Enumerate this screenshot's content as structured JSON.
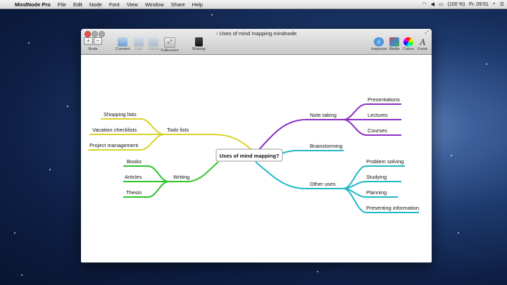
{
  "menubar": {
    "app_name": "MindNode Pro",
    "items": [
      "File",
      "Edit",
      "Node",
      "Font",
      "View",
      "Window",
      "Share",
      "Help"
    ],
    "battery": "(100 %)",
    "clock": "Fr. 09:51"
  },
  "window": {
    "title": "Uses of mind mapping.mindnode",
    "toolbar": {
      "node_label": "Node",
      "node_add": "+",
      "node_remove": "−",
      "connect": "Connect",
      "fold": "Fold",
      "unfold": "Unfold",
      "fullscreen": "Fullscreen",
      "sharing": "Sharing",
      "inspector": "Inspector",
      "media": "Media",
      "colors": "Colors",
      "fonts": "Fonts"
    }
  },
  "mindmap": {
    "root": "Uses of mind mapping?",
    "branches": {
      "note_taking": {
        "label": "Note taking",
        "children": [
          "Presentations",
          "Lectures",
          "Courses"
        ]
      },
      "brainstorming": {
        "label": "Brainstorming"
      },
      "other_uses": {
        "label": "Other uses",
        "children": [
          "Problem solving",
          "Studying",
          "Planning",
          "Presenting information"
        ]
      },
      "todo_lists": {
        "label": "Todo lists",
        "children": [
          "Shopping lists",
          "Vacation checklists",
          "Project management"
        ]
      },
      "writing": {
        "label": "Writing",
        "children": [
          "Books",
          "Articles",
          "Thesis"
        ]
      }
    },
    "colors": {
      "purple": "#8a2fc4",
      "teal": "#1fb8c4",
      "yellow": "#d8d22a",
      "green": "#2ec42e"
    }
  }
}
